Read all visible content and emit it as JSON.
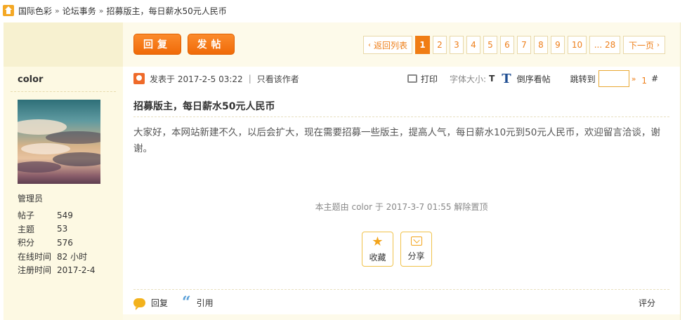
{
  "breadcrumb": {
    "items": [
      "国际色彩",
      "论坛事务",
      "招募版主，每日薪水50元人民币"
    ],
    "separator": "»"
  },
  "actions": {
    "reply_label": "回复",
    "post_label": "发帖"
  },
  "pager": {
    "back_label": "返回列表",
    "pages": [
      "1",
      "2",
      "3",
      "4",
      "5",
      "6",
      "7",
      "8",
      "9",
      "10"
    ],
    "current": "1",
    "last": "... 28",
    "next_label": "下一页"
  },
  "author": {
    "name": "color",
    "group": "管理员",
    "stats": [
      {
        "label": "帖子",
        "value": "549"
      },
      {
        "label": "主题",
        "value": "53"
      },
      {
        "label": "积分",
        "value": "576"
      },
      {
        "label": "在线时间",
        "value": "82 小时"
      },
      {
        "label": "注册时间",
        "value": "2017-2-4"
      }
    ]
  },
  "post": {
    "posted_at": "发表于 2017-2-5 03:22",
    "only_author": "只看该作者",
    "pipe": "|",
    "print_label": "打印",
    "font_size_label": "字体大小:",
    "font_small": "T",
    "font_big": "T",
    "reverse_label": "倒序看帖",
    "jump_label": "跳转到",
    "jump_go": "»",
    "floor": "1",
    "floor_hash": "#",
    "title": "招募版主，每日薪水50元人民币",
    "content": "大家好，本网站新建不久，以后会扩大，现在需要招募一些版主，提高人气，每日薪水10元到50元人民币，欢迎留言洽谈，谢谢。",
    "sticky_note": "本主题由 color 于 2017-3-7 01:55 解除置顶",
    "favorite_label": "收藏",
    "share_label": "分享",
    "reply_label": "回复",
    "quote_label": "引用",
    "rate_label": "评分"
  },
  "colors": {
    "accent": "#f07d14",
    "sidebar_bg": "#fdf9e3"
  }
}
